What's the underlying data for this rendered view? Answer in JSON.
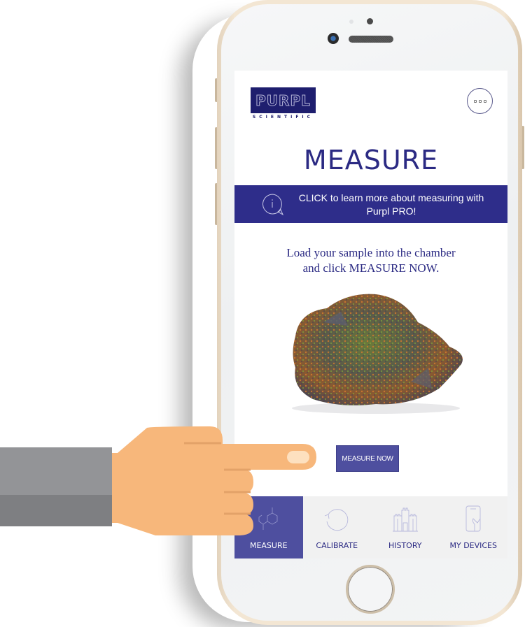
{
  "app": {
    "brand_name": "PURPL",
    "brand_sub": "SCIENTIFIC",
    "menu_icon": "more-dots-icon"
  },
  "page": {
    "title": "MEASURE"
  },
  "info_banner": {
    "icon": "info-chat-icon",
    "text": "CLICK to learn more about measuring with Purpl PRO!"
  },
  "instruction": {
    "line1": "Load your sample into the chamber",
    "line2": "and click MEASURE NOW."
  },
  "sample_image": {
    "alt": "cannabis-bud-sample"
  },
  "measure_button": {
    "label": "MEASURE NOW"
  },
  "tabbar": {
    "active": "MEASURE",
    "tabs": [
      {
        "label": "MEASURE",
        "icon": "molecule-icon"
      },
      {
        "label": "CALIBRATE",
        "icon": "refresh-icon"
      },
      {
        "label": "HISTORY",
        "icon": "castle-icon"
      },
      {
        "label": "MY DEVICES",
        "icon": "phone-hand-icon"
      }
    ]
  },
  "colors": {
    "brand_navy": "#1e1e6e",
    "banner": "#2e2d8a",
    "accent": "#4e4f9f",
    "text_primary": "#2b2a83",
    "tabbar_bg": "#f1f1f1",
    "skin": "#f7b77b",
    "sleeve": "#939497"
  }
}
